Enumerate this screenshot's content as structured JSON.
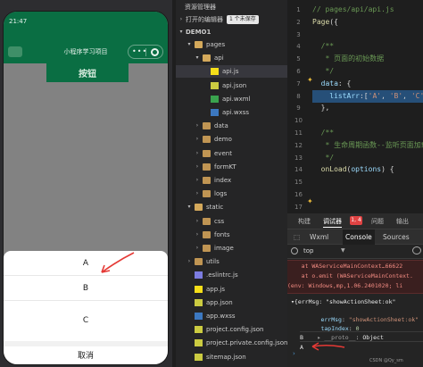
{
  "simulator": {
    "time": "21:47",
    "nav_title": "小程序学习项目",
    "capsule_dots": "•••",
    "main_button": "按钮",
    "action_sheet": {
      "options": [
        "A",
        "B",
        "C"
      ],
      "cancel": "取消"
    },
    "annotation_color": "#e53935"
  },
  "explorer": {
    "title": "资源管理器",
    "open_editors": "打开的编辑器",
    "unsaved_badge": "1 个未保存",
    "project": "DEMO1",
    "tree": [
      {
        "label": "pages",
        "kind": "folder-open",
        "arrow": "▾",
        "indent": 1
      },
      {
        "label": "api",
        "kind": "folder-open",
        "arrow": "▾",
        "indent": 2
      },
      {
        "label": "api.js",
        "kind": "js",
        "arrow": "",
        "indent": 3,
        "selected": true
      },
      {
        "label": "api.json",
        "kind": "json",
        "arrow": "",
        "indent": 3
      },
      {
        "label": "api.wxml",
        "kind": "wxml",
        "arrow": "",
        "indent": 3
      },
      {
        "label": "api.wxss",
        "kind": "wxss",
        "arrow": "",
        "indent": 3
      },
      {
        "label": "data",
        "kind": "folder",
        "arrow": "›",
        "indent": 2
      },
      {
        "label": "demo",
        "kind": "folder",
        "arrow": "›",
        "indent": 2
      },
      {
        "label": "event",
        "kind": "folder",
        "arrow": "›",
        "indent": 2
      },
      {
        "label": "formKT",
        "kind": "folder",
        "arrow": "›",
        "indent": 2
      },
      {
        "label": "index",
        "kind": "folder",
        "arrow": "›",
        "indent": 2
      },
      {
        "label": "logs",
        "kind": "folder",
        "arrow": "›",
        "indent": 2
      },
      {
        "label": "static",
        "kind": "folder-open",
        "arrow": "▾",
        "indent": 1
      },
      {
        "label": "css",
        "kind": "folder",
        "arrow": "›",
        "indent": 2
      },
      {
        "label": "fonts",
        "kind": "folder",
        "arrow": "›",
        "indent": 2
      },
      {
        "label": "image",
        "kind": "folder",
        "arrow": "›",
        "indent": 2
      },
      {
        "label": "utils",
        "kind": "folder",
        "arrow": "›",
        "indent": 1
      },
      {
        "label": ".eslintrc.js",
        "kind": "rc",
        "arrow": "",
        "indent": 1
      },
      {
        "label": "app.js",
        "kind": "js",
        "arrow": "",
        "indent": 1
      },
      {
        "label": "app.json",
        "kind": "json",
        "arrow": "",
        "indent": 1
      },
      {
        "label": "app.wxss",
        "kind": "wxss",
        "arrow": "",
        "indent": 1
      },
      {
        "label": "project.config.json",
        "kind": "json",
        "arrow": "",
        "indent": 1
      },
      {
        "label": "project.private.config.json",
        "kind": "json",
        "arrow": "",
        "indent": 1
      },
      {
        "label": "sitemap.json",
        "kind": "json",
        "arrow": "",
        "indent": 1
      }
    ]
  },
  "editor": {
    "lines": [
      {
        "num": "1",
        "parts": [
          [
            "c-com",
            "// pages/api/api.js"
          ]
        ]
      },
      {
        "num": "2",
        "parts": [
          [
            "c-fn",
            "Page"
          ],
          [
            "c-pun",
            "({"
          ]
        ]
      },
      {
        "num": "3",
        "parts": []
      },
      {
        "num": "4",
        "parts": [
          [
            "c-com",
            "  /**"
          ]
        ]
      },
      {
        "num": "5",
        "parts": [
          [
            "c-com",
            "   * 页面的初始数据"
          ]
        ]
      },
      {
        "num": "6",
        "parts": [
          [
            "c-com",
            "   */"
          ]
        ]
      },
      {
        "num": "7",
        "parts": [
          [
            "c-prop",
            "  data"
          ],
          [
            "c-pun",
            ": {"
          ]
        ]
      },
      {
        "num": "8",
        "parts": [
          [
            "c-prop",
            "    listArr"
          ],
          [
            "c-pun",
            ":["
          ],
          [
            "c-str",
            "'A'"
          ],
          [
            "c-pun",
            ", "
          ],
          [
            "c-str",
            "'B'"
          ],
          [
            "c-pun",
            ", "
          ],
          [
            "c-str",
            "'C'"
          ],
          [
            "c-pun",
            "]"
          ]
        ],
        "highlight": true
      },
      {
        "num": "9",
        "parts": [
          [
            "c-pun",
            "  },"
          ]
        ]
      },
      {
        "num": "10",
        "parts": []
      },
      {
        "num": "11",
        "parts": [
          [
            "c-com",
            "  /**"
          ]
        ]
      },
      {
        "num": "12",
        "parts": [
          [
            "c-com",
            "   * 生命周期函数--监听页面加载"
          ]
        ]
      },
      {
        "num": "13",
        "parts": [
          [
            "c-com",
            "   */"
          ]
        ]
      },
      {
        "num": "14",
        "parts": [
          [
            "c-fn",
            "  onLoad"
          ],
          [
            "c-pun",
            "("
          ],
          [
            "c-prop",
            "options"
          ],
          [
            "c-pun",
            ") {"
          ]
        ]
      },
      {
        "num": "15",
        "parts": []
      },
      {
        "num": "16",
        "parts": []
      },
      {
        "num": "17",
        "parts": []
      }
    ]
  },
  "devtools": {
    "tabs_top": [
      "构建",
      "调试器",
      "问题",
      "输出"
    ],
    "error_count": "1, 4",
    "tabs": [
      "Wxml",
      "Console",
      "Sources"
    ],
    "active_tab": "Console",
    "context": "top",
    "error_lines": [
      "    at WAServiceMainContext…66622",
      "    at o.emit (WAServiceMainContext.",
      "(env: Windows,mp,1.06.2401020; li"
    ],
    "obj_header": "▾{errMsg: \"showActionSheet:ok\"",
    "obj_errmsg_key": "errMsg",
    "obj_errmsg_val": "\"showActionSheet:ok\"",
    "obj_tapindex_key": "tapIndex",
    "obj_tapindex_val": "0",
    "obj_proto_key": "__proto__",
    "obj_proto_val": "Object",
    "log_b": "B",
    "log_a": "A",
    "prompt": "›",
    "watermark": "CSDN @Qy_sm"
  }
}
